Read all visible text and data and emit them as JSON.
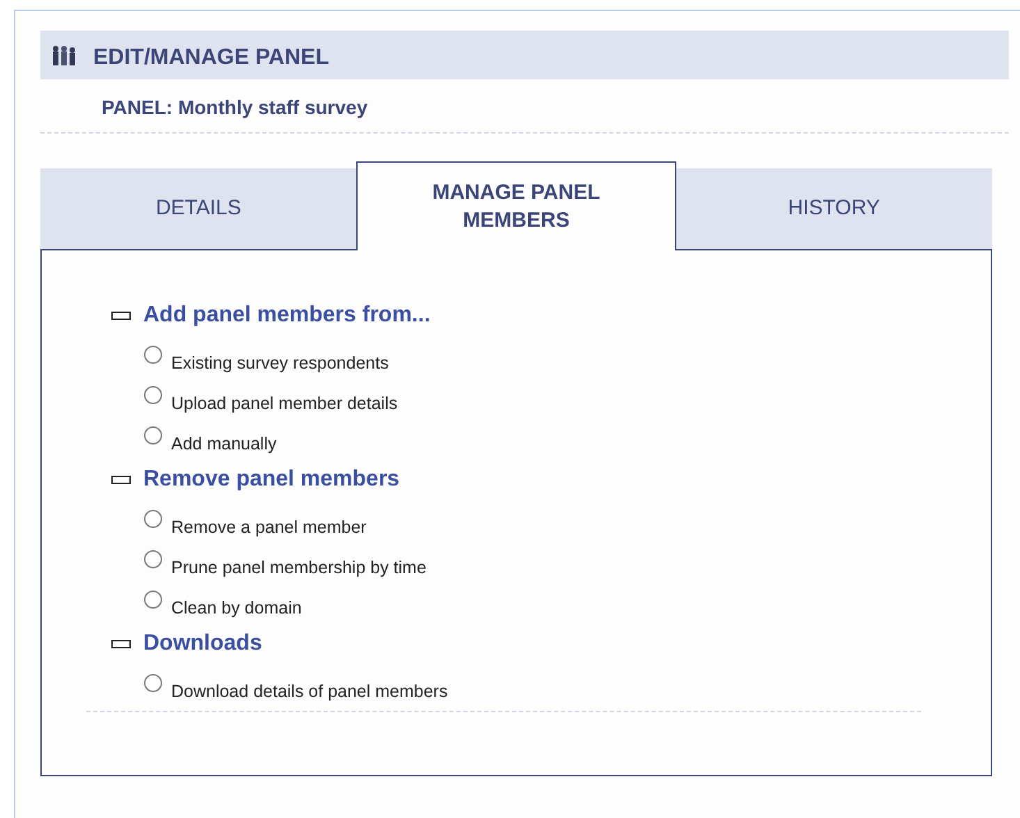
{
  "header": {
    "title": "EDIT/MANAGE PANEL"
  },
  "panel_name": "PANEL: Monthly staff survey",
  "tabs": [
    {
      "label": "DETAILS",
      "selected": false
    },
    {
      "label": "MANAGE PANEL MEMBERS",
      "selected": true
    },
    {
      "label": "HISTORY",
      "selected": false
    }
  ],
  "groups": [
    {
      "title": "Add panel members from...",
      "expanded": true,
      "options": [
        {
          "label": "Existing survey respondents",
          "selected": false
        },
        {
          "label": "Upload panel member details",
          "selected": false
        },
        {
          "label": "Add manually",
          "selected": false
        }
      ]
    },
    {
      "title": "Remove panel members",
      "expanded": true,
      "options": [
        {
          "label": "Remove a panel member",
          "selected": false
        },
        {
          "label": "Prune panel membership by time",
          "selected": false
        },
        {
          "label": "Clean by domain",
          "selected": false
        }
      ]
    },
    {
      "title": "Downloads",
      "expanded": true,
      "options": [
        {
          "label": "Download details of panel members",
          "selected": false
        }
      ]
    }
  ]
}
